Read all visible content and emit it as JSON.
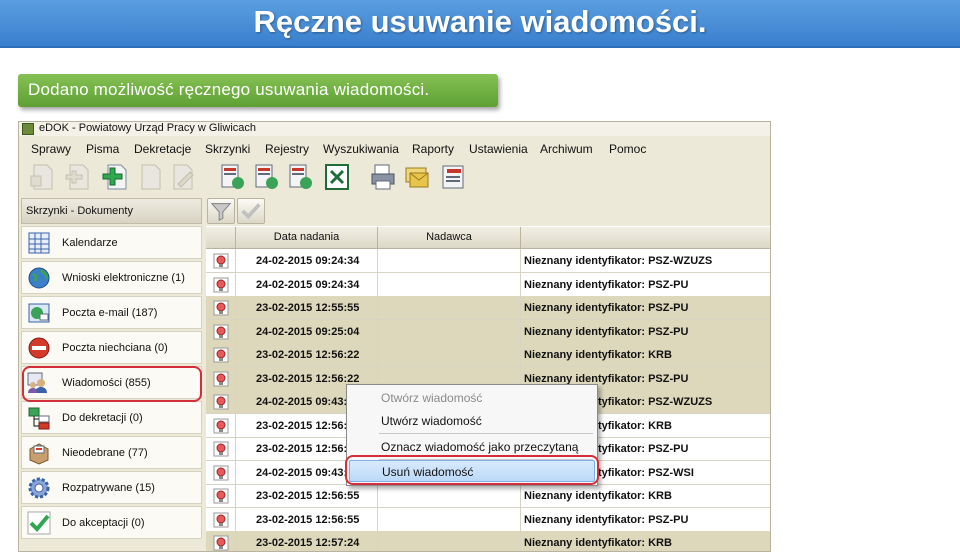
{
  "slide": {
    "title": "Ręczne usuwanie wiadomości.",
    "subtitle": "Dodano możliwość ręcznego usuwania wiadomości."
  },
  "window": {
    "title": "eDOK - Powiatowy Urząd Pracy w Gliwicach"
  },
  "menu": [
    "Sprawy",
    "Pisma",
    "Dekretacje",
    "Skrzynki",
    "Rejestry",
    "Wyszukiwania",
    "Raporty",
    "Ustawienia",
    "Archiwum",
    "Pomoc"
  ],
  "left_panel": {
    "header": "Skrzynki - Dokumenty",
    "items": [
      {
        "label": "Kalendarze",
        "icon": "calendar-icon"
      },
      {
        "label": "Wnioski elektroniczne (1)",
        "icon": "globe-icon"
      },
      {
        "label": "Poczta e-mail (187)",
        "icon": "email-icon"
      },
      {
        "label": "Poczta niechciana (0)",
        "icon": "blocked-icon"
      },
      {
        "label": "Wiadomości (855)",
        "icon": "messages-icon"
      },
      {
        "label": "Do dekretacji (0)",
        "icon": "decree-icon"
      },
      {
        "label": "Nieodebrane (77)",
        "icon": "package-icon"
      },
      {
        "label": "Rozpatrywane (15)",
        "icon": "gear-icon"
      },
      {
        "label": "Do akceptacji (0)",
        "icon": "checkmark-icon"
      }
    ]
  },
  "grid": {
    "columns": [
      "Data nadania",
      "Nadawca",
      ""
    ],
    "rows": [
      {
        "date": "24-02-2015 09:24:34",
        "sender": "",
        "subject": "Nieznany identyfikator: PSZ-WZUZS"
      },
      {
        "date": "24-02-2015 09:24:34",
        "sender": "",
        "subject": "Nieznany identyfikator: PSZ-PU"
      },
      {
        "date": "23-02-2015 12:55:55",
        "sender": "",
        "subject": "Nieznany identyfikator: PSZ-PU"
      },
      {
        "date": "24-02-2015 09:25:04",
        "sender": "",
        "subject": "Nieznany identyfikator: PSZ-PU"
      },
      {
        "date": "23-02-2015 12:56:22",
        "sender": "",
        "subject": "Nieznany identyfikator: KRB"
      },
      {
        "date": "23-02-2015 12:56:22",
        "sender": "",
        "subject": "Nieznany identyfikator: PSZ-PU"
      },
      {
        "date": "24-02-2015 09:43:38",
        "sender": "",
        "subject": "Nieznany identyfikator: PSZ-WZUZS"
      },
      {
        "date": "23-02-2015 12:56:22",
        "sender": "",
        "subject": "Nieznany identyfikator: KRB"
      },
      {
        "date": "23-02-2015 12:56:22",
        "sender": "",
        "subject": "Nieznany identyfikator: PSZ-PU"
      },
      {
        "date": "24-02-2015 09:43:38",
        "sender": "",
        "subject": "Nieznany identyfikator: PSZ-WSI"
      },
      {
        "date": "23-02-2015 12:56:55",
        "sender": "",
        "subject": "Nieznany identyfikator: KRB"
      },
      {
        "date": "23-02-2015 12:56:55",
        "sender": "",
        "subject": "Nieznany identyfikator: PSZ-PU"
      },
      {
        "date": "23-02-2015 12:57:24",
        "sender": "",
        "subject": "Nieznany identyfikator: KRB"
      }
    ]
  },
  "context_menu": {
    "items": [
      {
        "label": "Otwórz wiadomość",
        "state": "disabled"
      },
      {
        "label": "Utwórz wiadomość",
        "state": "normal"
      },
      {
        "label": "Oznacz wiadomość jako przeczytaną",
        "state": "normal"
      },
      {
        "label": "Usuń wiadomość",
        "state": "selected"
      }
    ]
  },
  "colors": {
    "header_blue": "#3a7fce",
    "subtitle_green": "#6aaa3c",
    "highlight_red": "#d32f3a",
    "row_alt": "#ddd8bc"
  }
}
